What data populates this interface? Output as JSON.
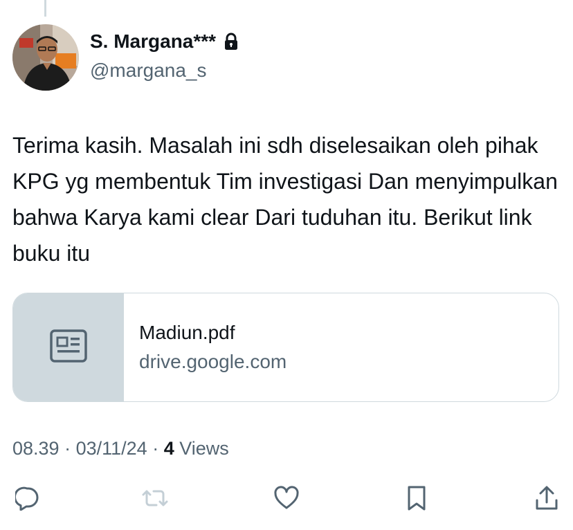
{
  "author": {
    "name": "S. Margana***",
    "handle": "@margana_s",
    "protected_icon": "lock-icon"
  },
  "tweet": {
    "text": "Terima kasih. Masalah ini sdh diselesaikan oleh pihak KPG yg membentuk Tim investigasi Dan menyimpulkan bahwa Karya kami clear Dari tuduhan itu. Berikut link buku itu"
  },
  "link_card": {
    "title": "Madiun.pdf",
    "domain": "drive.google.com",
    "thumb_icon": "article-icon"
  },
  "meta": {
    "time": "08.39",
    "separator1": " · ",
    "date": "03/11/24",
    "separator2": " · ",
    "views_count": "4",
    "views_label": " Views"
  },
  "actions": [
    {
      "icon": "reply-icon"
    },
    {
      "icon": "retweet-icon"
    },
    {
      "icon": "like-icon"
    },
    {
      "icon": "bookmark-icon"
    },
    {
      "icon": "share-icon"
    }
  ],
  "colors": {
    "text_primary": "#0f1419",
    "text_secondary": "#536471",
    "border": "#cfd9de",
    "disabled_icon": "#c4cfd6"
  }
}
